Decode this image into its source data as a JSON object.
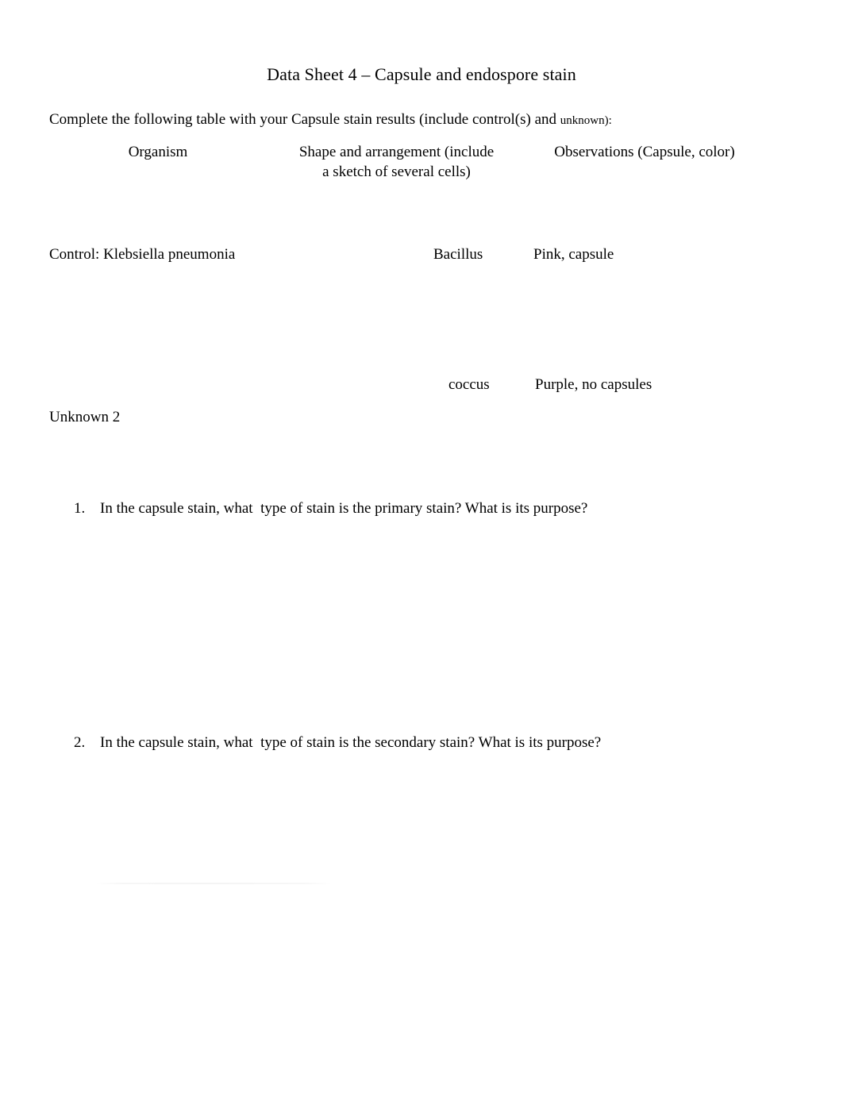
{
  "document": {
    "title": "Data Sheet 4 – Capsule and endospore stain",
    "intro": {
      "main_text": "Complete the following table with your Capsule stain results (include control(s) and ",
      "small_text": "unknown):"
    }
  },
  "table": {
    "headers": {
      "organism": "Organism",
      "shape_line1": "Shape and arrangement (include",
      "shape_line2": "a sketch of several cells)",
      "observations": "Observations (Capsule, color)"
    },
    "rows": [
      {
        "organism": "Control: Klebsiella pneumonia",
        "shape": "Bacillus",
        "observations": "Pink, capsule",
        "shape_continued": "coccus",
        "observations_continued": "Purple, no capsules"
      },
      {
        "organism": "Unknown 2",
        "shape": "",
        "observations": ""
      }
    ]
  },
  "questions": [
    {
      "number": "1.",
      "text": "In the capsule stain, what  type of stain is the primary stain? What is its purpose?"
    },
    {
      "number": "2.",
      "text": "In the capsule stain, what  type of stain is the secondary stain? What is its purpose?"
    }
  ]
}
